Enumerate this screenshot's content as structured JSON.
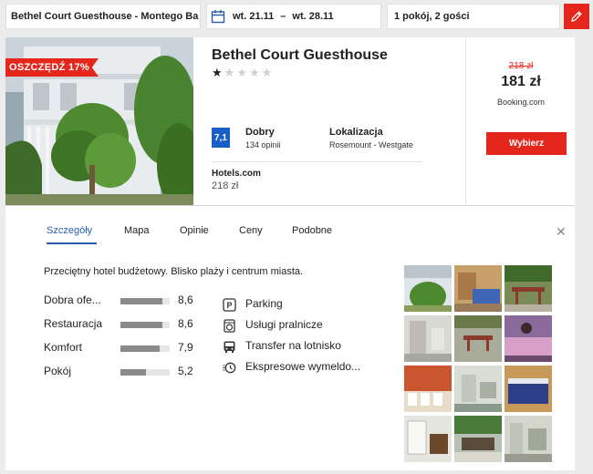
{
  "search": {
    "destination": "Bethel Court Guesthouse - Montego Ba",
    "date_from": "wt. 21.11",
    "date_sep": "–",
    "date_to": "wt. 28.11",
    "guests": "1 pokój, 2 gości"
  },
  "hotel": {
    "savings_badge": "OSZCZĘDŹ 17%",
    "name": "Bethel Court Guesthouse",
    "stars": 1,
    "stars_max": 5,
    "score": "7,1",
    "score_word": "Dobry",
    "score_count": "134 opinii",
    "location_heading": "Lokalizacja",
    "location_value": "Rosemount - Westgate",
    "alt_provider": "Hotels.com",
    "alt_price": "218 zł",
    "old_price": "218 zł",
    "price": "181 zł",
    "provider": "Booking.com",
    "choose_label": "Wybierz"
  },
  "tabs": [
    {
      "label": "Szczegóły",
      "active": true
    },
    {
      "label": "Mapa",
      "active": false
    },
    {
      "label": "Opinie",
      "active": false
    },
    {
      "label": "Ceny",
      "active": false
    },
    {
      "label": "Podobne",
      "active": false
    }
  ],
  "details": {
    "description": "Przeciętny hotel budżetowy. Blisko plaży i centrum miasta.",
    "ratings": [
      {
        "label": "Dobra ofe...",
        "value": "8,6",
        "fraction": 0.86
      },
      {
        "label": "Restauracja",
        "value": "8,6",
        "fraction": 0.86
      },
      {
        "label": "Komfort",
        "value": "7,9",
        "fraction": 0.79
      },
      {
        "label": "Pokój",
        "value": "5,2",
        "fraction": 0.52
      }
    ],
    "amenities": [
      {
        "icon": "parking-icon",
        "label": "Parking"
      },
      {
        "icon": "laundry-icon",
        "label": "Usługi pralnicze"
      },
      {
        "icon": "shuttle-bus-icon",
        "label": "Transfer na lotnisko"
      },
      {
        "icon": "express-checkout-icon",
        "label": "Ekspresowe wymeldo..."
      }
    ]
  },
  "colors": {
    "accent_red": "#e4261c",
    "score_blue": "#1a5fc8",
    "tab_active": "#2a5cad"
  }
}
